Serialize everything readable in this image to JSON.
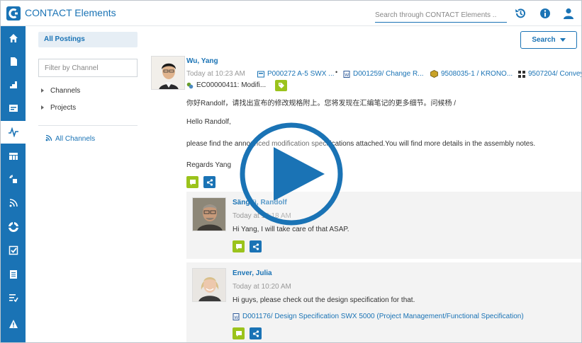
{
  "app": {
    "title": "CONTACT Elements",
    "search_placeholder": "Search through CONTACT Elements ..",
    "logo_icon": "contact-logo-icon"
  },
  "colors": {
    "primary": "#1a73b5",
    "accent_green": "#9bc31c"
  },
  "header_icons": [
    "history-icon",
    "info-icon",
    "user-icon"
  ],
  "nav": [
    "home-icon",
    "document-icon",
    "chart-icon",
    "form-icon",
    "activity-icon",
    "table-icon",
    "share-icon",
    "signal-icon",
    "org-icon",
    "check-icon",
    "list-icon",
    "tasks-icon",
    "warning-icon"
  ],
  "panel": {
    "all_postings": "All Postings",
    "filter_placeholder": "Filter by Channel",
    "tree": [
      "Channels",
      "Projects"
    ],
    "all_channels": "All Channels"
  },
  "search_button": {
    "label": "Search"
  },
  "post": {
    "author": "Wu, Yang",
    "time": "Today at 10:23 AM",
    "refs": [
      "P000272 A-5 SWX ...",
      "D001259/ Change R...",
      "9508035-1 / KRONO...",
      "9507204/ Convey"
    ],
    "ref2": "EC00000411: Modifi...",
    "lines": [
      "你好Randolf，请找出宣布的修改规格附上。您将发现在汇编笔记的更多细节。问候杨 /",
      "Hello Randolf,",
      "please find the announced modification specifications attached.You will find more details in the assembly notes.",
      "Regards Yang"
    ]
  },
  "replies": [
    {
      "author": "Sängfü, Randolf",
      "time": "Today at 10:18 AM",
      "text": "Hi Yang, I will take care of that ASAP."
    },
    {
      "author": "Enver, Julia",
      "time": "Today at 10:20 AM",
      "text": "Hi guys, please check out the design specification for that.",
      "attachment": "D001176/ Design Specification SWX 5000 (Project Management/Functional Specification)"
    }
  ]
}
